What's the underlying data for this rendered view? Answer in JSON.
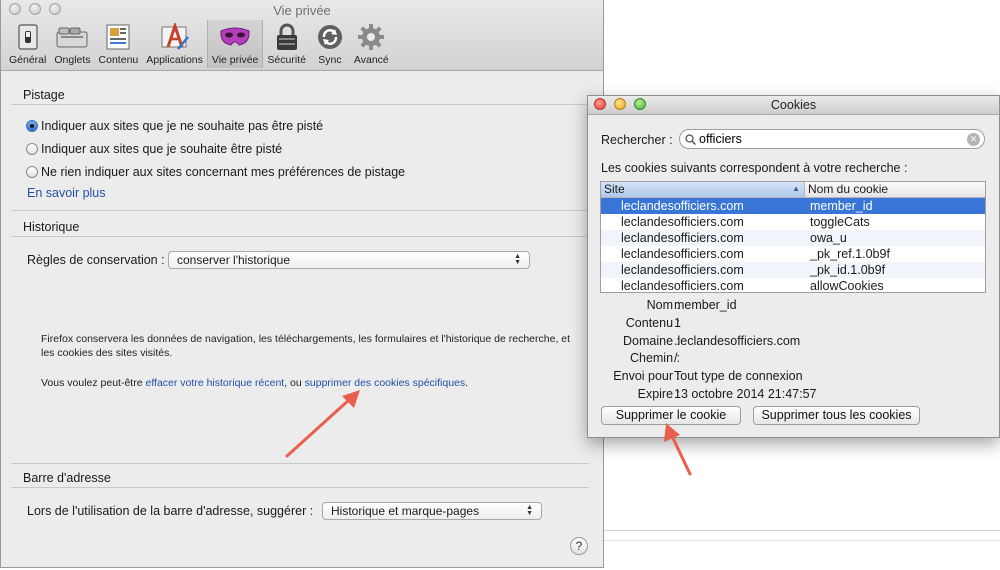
{
  "prefs": {
    "title": "Vie privée",
    "toolbar": [
      {
        "label": "Général",
        "icon": "general-switch-icon"
      },
      {
        "label": "Onglets",
        "icon": "tabs-icon"
      },
      {
        "label": "Contenu",
        "icon": "content-icon"
      },
      {
        "label": "Applications",
        "icon": "applications-icon"
      },
      {
        "label": "Vie privée",
        "icon": "privacy-mask-icon"
      },
      {
        "label": "Sécurité",
        "icon": "padlock-icon"
      },
      {
        "label": "Sync",
        "icon": "sync-icon"
      },
      {
        "label": "Avancé",
        "icon": "gear-icon"
      }
    ],
    "tracking": {
      "title": "Pistage",
      "options": [
        "Indiquer aux sites que je ne souhaite pas être pisté",
        "Indiquer aux sites que je souhaite être pisté",
        "Ne rien indiquer aux sites concernant mes préférences de pistage"
      ],
      "selected": 0,
      "learn_more": "En savoir plus"
    },
    "history": {
      "title": "Historique",
      "rules_label": "Règles de conservation :",
      "rules_value": "conserver l'historique",
      "description": "Firefox conservera les données de navigation, les téléchargements, les formulaires et l'historique de recherche, et les cookies des sites visités.",
      "hint_prefix": "Vous voulez peut-être ",
      "hint_link1": "effacer votre historique récent",
      "hint_middle": ", ou ",
      "hint_link2": "supprimer des cookies spécifiques",
      "hint_suffix": "."
    },
    "addressbar": {
      "title": "Barre d'adresse",
      "label": "Lors de l'utilisation de la barre d'adresse, suggérer :",
      "value": "Historique et marque-pages"
    },
    "help": "?"
  },
  "cookies": {
    "title": "Cookies",
    "search_label": "Rechercher :",
    "search_value": "officiers",
    "results_label": "Les cookies suivants correspondent à votre recherche :",
    "columns": [
      "Site",
      "Nom du cookie"
    ],
    "rows": [
      {
        "site": "leclandesofficiers.com",
        "name": "member_id"
      },
      {
        "site": "leclandesofficiers.com",
        "name": "toggleCats"
      },
      {
        "site": "leclandesofficiers.com",
        "name": "owa_u"
      },
      {
        "site": "leclandesofficiers.com",
        "name": "_pk_ref.1.0b9f"
      },
      {
        "site": "leclandesofficiers.com",
        "name": "_pk_id.1.0b9f"
      },
      {
        "site": "leclandesofficiers.com",
        "name": "allowCookies"
      }
    ],
    "selected_row": 0,
    "details": [
      {
        "key": "Nom :",
        "value": "member_id"
      },
      {
        "key": "Contenu :",
        "value": "1"
      },
      {
        "key": "Domaine :",
        "value": ".leclandesofficiers.com"
      },
      {
        "key": "Chemin :",
        "value": "/"
      },
      {
        "key": "Envoi pour :",
        "value": "Tout type de connexion"
      },
      {
        "key": "Expire :",
        "value": "13 octobre 2014 21:47:57"
      }
    ],
    "delete_button": "Supprimer le cookie",
    "delete_all_button": "Supprimer tous les cookies"
  },
  "colors": {
    "selection": "#3875d7",
    "link": "#2250a8",
    "annotation_arrow": "#e8604c"
  }
}
